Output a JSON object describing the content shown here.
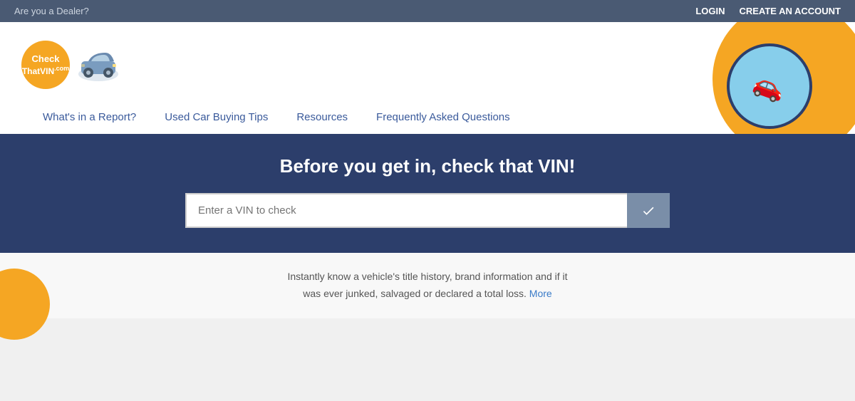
{
  "topbar": {
    "dealer_text": "Are you a Dealer?",
    "login_label": "LOGIN",
    "create_account_label": "CREATE AN ACCOUNT"
  },
  "logo": {
    "line1": "Check",
    "line2": "That",
    "line3": "VIN",
    "line4": ".com"
  },
  "nav": {
    "items": [
      {
        "label": "What's in a Report?",
        "id": "whats-in-report"
      },
      {
        "label": "Used Car Buying Tips",
        "id": "used-car-tips"
      },
      {
        "label": "Resources",
        "id": "resources"
      },
      {
        "label": "Frequently Asked Questions",
        "id": "faq"
      }
    ]
  },
  "hero": {
    "title": "Before you get in, check that VIN!",
    "input_placeholder": "Enter a VIN to check",
    "submit_label": "Go"
  },
  "info": {
    "text1": "Instantly know a vehicle's title history, brand information and if it",
    "text2": "was ever junked, salvaged or declared a total loss.",
    "more_label": "More"
  }
}
